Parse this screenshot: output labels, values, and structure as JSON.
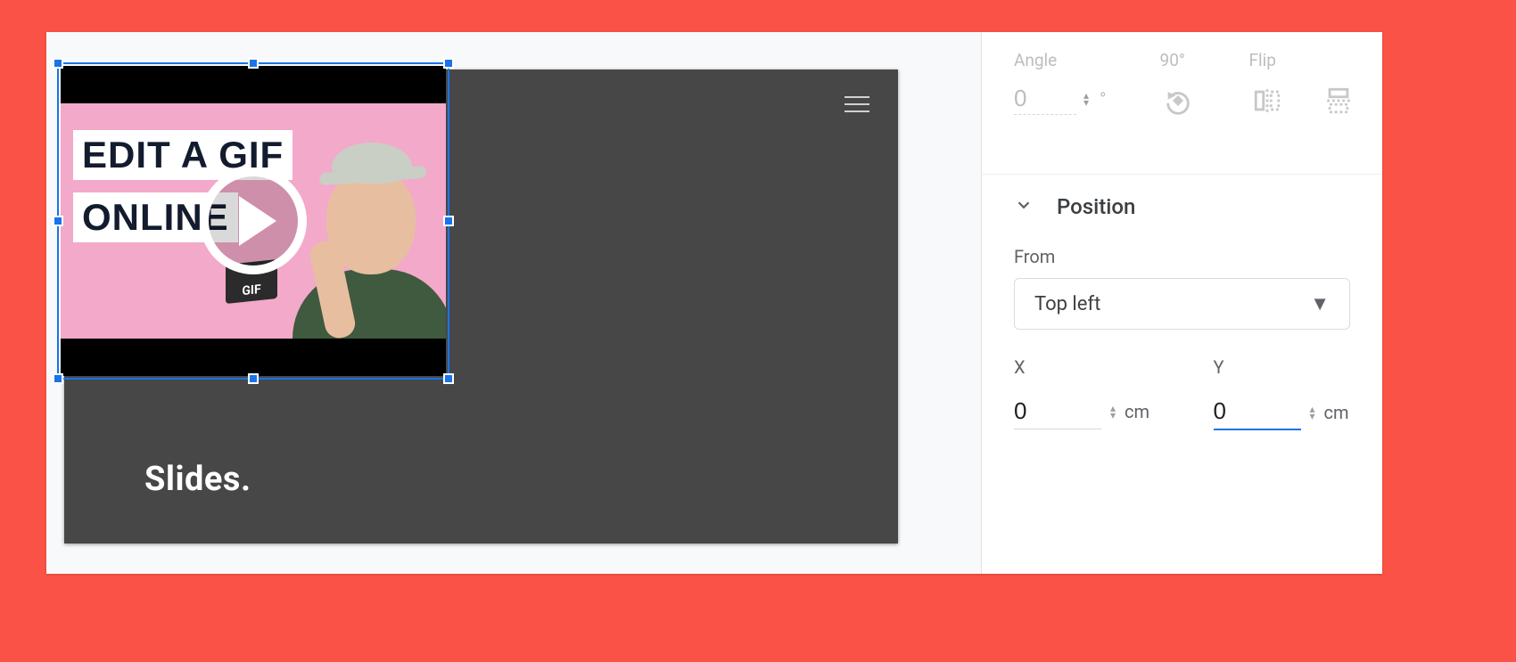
{
  "slide": {
    "text_fragment": "Slides.",
    "video": {
      "label_line1": "EDIT A GIF",
      "label_line2": "ONLINE",
      "badge": "GIF"
    }
  },
  "rotation": {
    "angle_label": "Angle",
    "angle_value": "0",
    "degree_symbol": "°",
    "rotate90_label": "90°",
    "flip_label": "Flip"
  },
  "position": {
    "section_title": "Position",
    "from_label": "From",
    "from_value": "Top left",
    "x_label": "X",
    "x_value": "0",
    "x_unit": "cm",
    "y_label": "Y",
    "y_value": "0",
    "y_unit": "cm"
  }
}
